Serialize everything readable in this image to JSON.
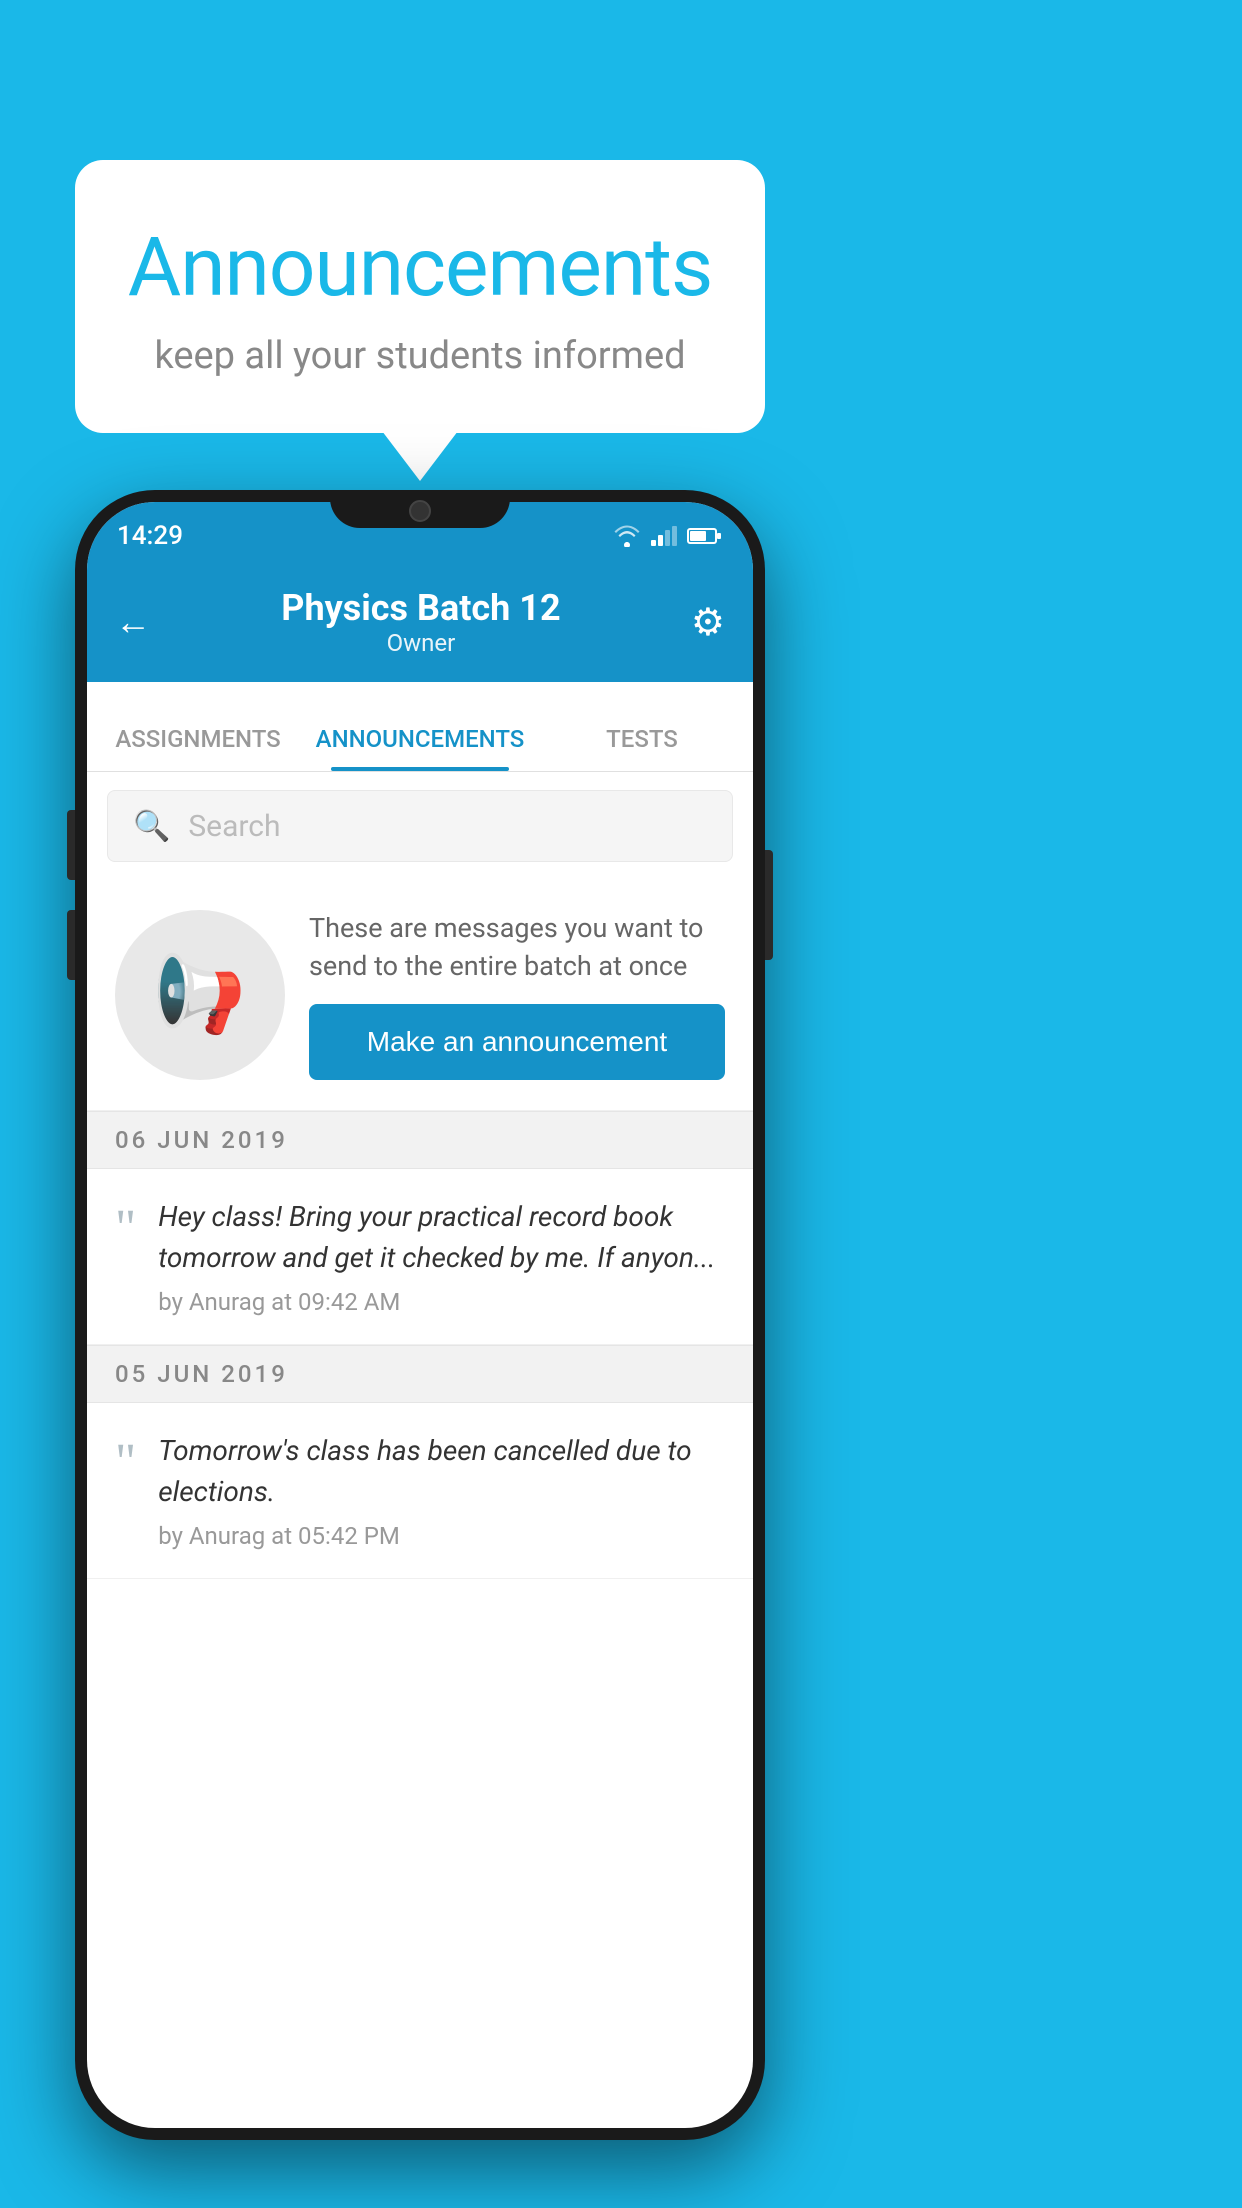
{
  "background_color": "#1ab8e8",
  "speech_bubble": {
    "title": "Announcements",
    "subtitle": "keep all your students informed"
  },
  "status_bar": {
    "time": "14:29"
  },
  "app_header": {
    "title": "Physics Batch 12",
    "subtitle": "Owner",
    "back_label": "←"
  },
  "tabs": [
    {
      "label": "ASSIGNMENTS",
      "active": false
    },
    {
      "label": "ANNOUNCEMENTS",
      "active": true
    },
    {
      "label": "TESTS",
      "active": false
    }
  ],
  "search": {
    "placeholder": "Search"
  },
  "promo": {
    "text": "These are messages you want to send to the entire batch at once",
    "button_label": "Make an announcement"
  },
  "announcements": [
    {
      "date": "06  JUN  2019",
      "text": "Hey class! Bring your practical record book tomorrow and get it checked by me. If anyon...",
      "meta": "by Anurag at 09:42 AM"
    },
    {
      "date": "05  JUN  2019",
      "text": "Tomorrow's class has been cancelled due to elections.",
      "meta": "by Anurag at 05:42 PM"
    }
  ]
}
